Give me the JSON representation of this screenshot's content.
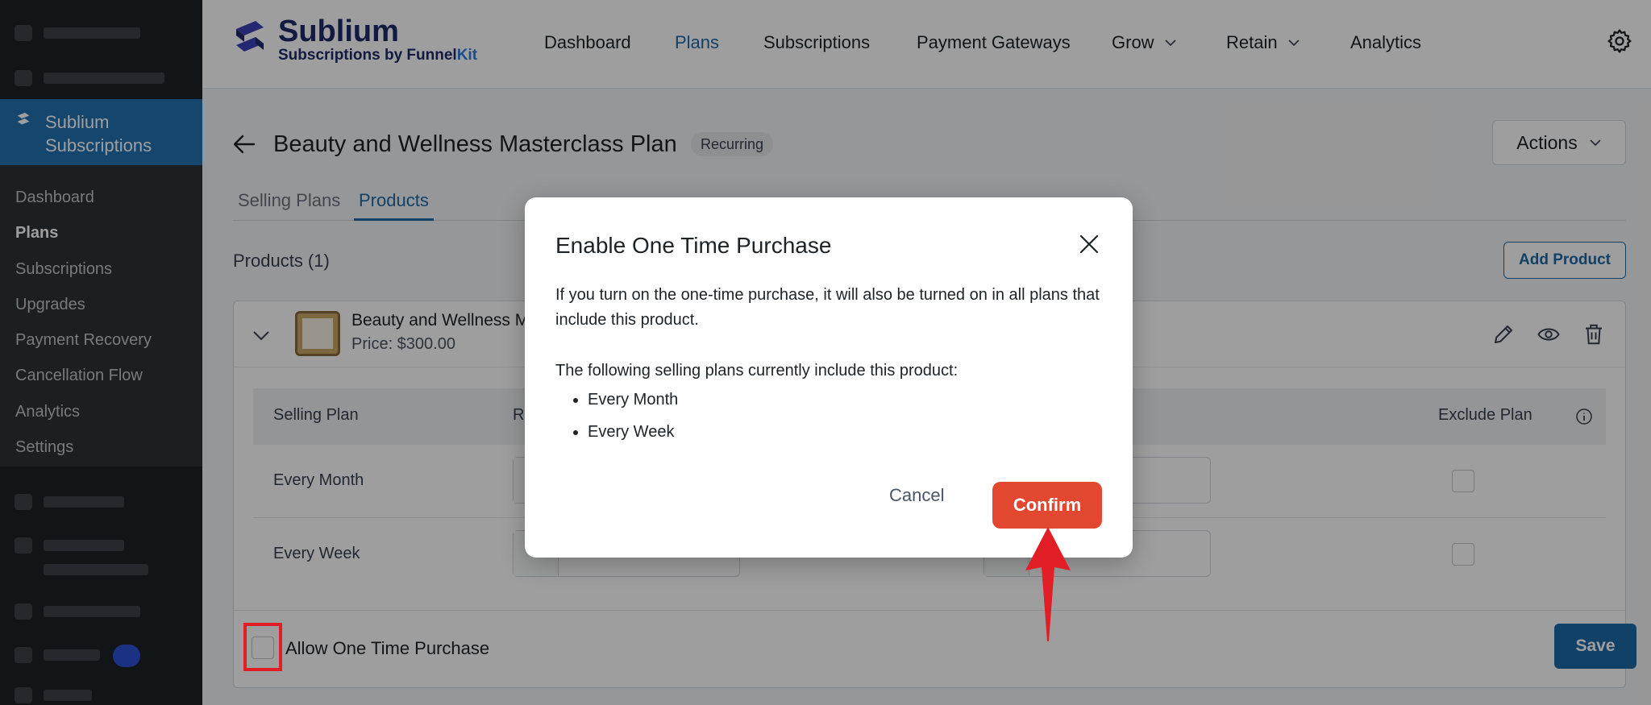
{
  "wp_sidebar": {
    "active_menu_label": "Sublium Subscriptions",
    "submenu": [
      {
        "label": "Dashboard"
      },
      {
        "label": "Plans"
      },
      {
        "label": "Subscriptions"
      },
      {
        "label": "Upgrades"
      },
      {
        "label": "Payment Recovery"
      },
      {
        "label": "Cancellation Flow"
      },
      {
        "label": "Analytics"
      },
      {
        "label": "Settings"
      }
    ]
  },
  "brand": {
    "name": "Sublium",
    "tagline_prefix": "Subscriptions by Funnel",
    "tagline_suffix": "Kit"
  },
  "topnav": [
    {
      "label": "Dashboard"
    },
    {
      "label": "Plans"
    },
    {
      "label": "Subscriptions"
    },
    {
      "label": "Payment Gateways"
    },
    {
      "label": "Grow"
    },
    {
      "label": "Retain"
    },
    {
      "label": "Analytics"
    }
  ],
  "page": {
    "title": "Beauty and Wellness Masterclass Plan",
    "badge": "Recurring",
    "actions_label": "Actions",
    "tabs": [
      {
        "label": "Selling Plans"
      },
      {
        "label": "Products"
      }
    ],
    "products_count": "Products (1)",
    "add_product_label": "Add Product"
  },
  "product": {
    "name": "Beauty and Wellness M",
    "price": "Price: $300.00",
    "table": {
      "headers": [
        "Selling Plan",
        "R",
        "Exclude Plan"
      ],
      "rows": [
        {
          "plan": "Every Month"
        },
        {
          "plan": "Every Week"
        }
      ]
    },
    "one_time_label": "Allow One Time Purchase",
    "save_label": "Save"
  },
  "modal": {
    "title": "Enable One Time Purchase",
    "body": "If you turn on the one-time purchase, it will also be turned on in all plans that include this product.",
    "list_intro": "The following selling plans currently include this product:",
    "plans": [
      "Every Month",
      "Every Week"
    ],
    "cancel_label": "Cancel",
    "confirm_label": "Confirm"
  },
  "colors": {
    "accent": "#1e6aa8",
    "confirm": "#e2482f",
    "highlight": "#e11d26"
  }
}
